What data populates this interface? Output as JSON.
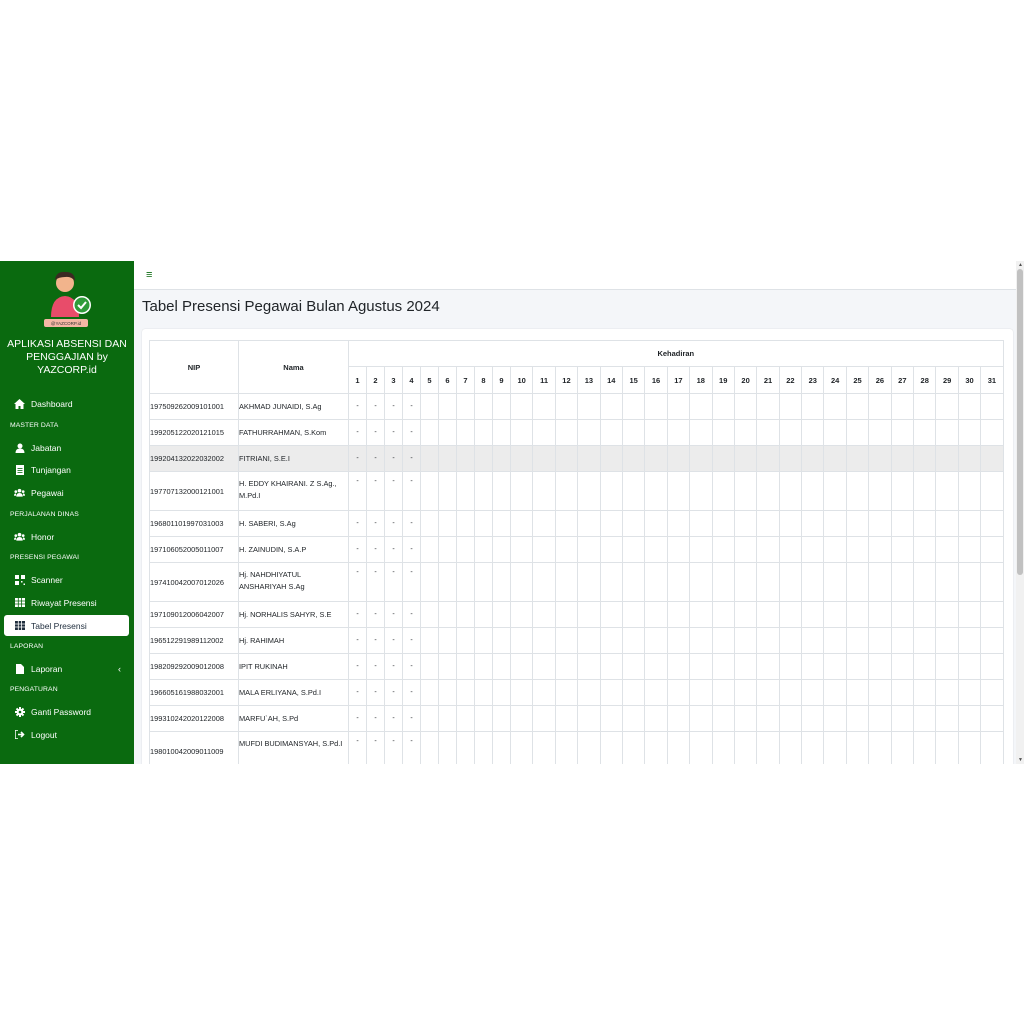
{
  "sidebar": {
    "brand": "APLIKASI ABSENSI DAN PENGGAJIAN by YAZCORP.id",
    "logo_text": "@YAZCORP.id",
    "items": [
      {
        "label": "Dashboard",
        "icon": "home-icon"
      },
      {
        "label": "Jabatan",
        "icon": "user-tie-icon"
      },
      {
        "label": "Tunjangan",
        "icon": "document-icon"
      },
      {
        "label": "Pegawai",
        "icon": "users-icon"
      },
      {
        "label": "Honor",
        "icon": "users-icon"
      },
      {
        "label": "Scanner",
        "icon": "qrcode-icon"
      },
      {
        "label": "Riwayat Presensi",
        "icon": "table-icon"
      },
      {
        "label": "Tabel Presensi",
        "icon": "table-icon",
        "active": true
      },
      {
        "label": "Laporan",
        "icon": "file-icon",
        "caret": "‹"
      },
      {
        "label": "Ganti Password",
        "icon": "gear-icon"
      },
      {
        "label": "Logout",
        "icon": "logout-icon"
      }
    ],
    "headers": [
      "MASTER DATA",
      "PERJALANAN DINAS",
      "PRESENSI PEGAWAI",
      "LAPORAN",
      "PENGATURAN"
    ]
  },
  "topbar": {
    "menu_icon": "≡"
  },
  "page": {
    "title": "Tabel Presensi Pegawai Bulan Agustus 2024"
  },
  "table": {
    "headers": {
      "nip": "NIP",
      "nama": "Nama",
      "kehadiran": "Kehadiran"
    },
    "days": [
      "1",
      "2",
      "3",
      "4",
      "5",
      "6",
      "7",
      "8",
      "9",
      "10",
      "11",
      "12",
      "13",
      "14",
      "15",
      "16",
      "17",
      "18",
      "19",
      "20",
      "21",
      "22",
      "23",
      "24",
      "25",
      "26",
      "27",
      "28",
      "29",
      "30",
      "31"
    ],
    "rows": [
      {
        "nip": "197509262009101001",
        "nama": "AKHMAD JUNAIDI, S.Ag",
        "marks": [
          "-",
          "-",
          "-",
          "-"
        ]
      },
      {
        "nip": "199205122020121015",
        "nama": "FATHURRAHMAN, S.Kom",
        "marks": [
          "-",
          "-",
          "-",
          "-"
        ]
      },
      {
        "nip": "199204132022032002",
        "nama": "FITRIANI, S.E.I",
        "marks": [
          "-",
          "-",
          "-",
          "-"
        ]
      },
      {
        "nip": "197707132000121001",
        "nama": "H. EDDY KHAIRANI. Z S.Ag., M.Pd.I",
        "marks": [
          "-",
          "-",
          "-",
          "-"
        ]
      },
      {
        "nip": "196801101997031003",
        "nama": "H. SABERI, S.Ag",
        "marks": [
          "-",
          "-",
          "-",
          "-"
        ]
      },
      {
        "nip": "197106052005011007",
        "nama": "H. ZAINUDIN, S.A.P",
        "marks": [
          "-",
          "-",
          "-",
          "-"
        ]
      },
      {
        "nip": "197410042007012026",
        "nama": "Hj. NAHDHIYATUL ANSHARIYAH S.Ag",
        "marks": [
          "-",
          "-",
          "-",
          "-"
        ]
      },
      {
        "nip": "197109012006042007",
        "nama": "Hj. NORHALIS SAHYR, S.E",
        "marks": [
          "-",
          "-",
          "-",
          "-"
        ]
      },
      {
        "nip": "196512291989112002",
        "nama": "Hj. RAHIMAH",
        "marks": [
          "-",
          "-",
          "-",
          "-"
        ]
      },
      {
        "nip": "198209292009012008",
        "nama": "IPIT RUKINAH",
        "marks": [
          "-",
          "-",
          "-",
          "-"
        ]
      },
      {
        "nip": "196605161988032001",
        "nama": "MALA ERLIYANA, S.Pd.I",
        "marks": [
          "-",
          "-",
          "-",
          "-"
        ]
      },
      {
        "nip": "199310242020122008",
        "nama": "MARFU`AH, S.Pd",
        "marks": [
          "-",
          "-",
          "-",
          "-"
        ]
      },
      {
        "nip": "198010042009011009",
        "nama": "MUFDI BUDIMANSYAH, S.Pd.I",
        "marks": [
          "-",
          "-",
          "-",
          "-"
        ]
      }
    ]
  },
  "colors": {
    "sidebar": "#0a6a0f",
    "highlight_row": "#ececec"
  }
}
